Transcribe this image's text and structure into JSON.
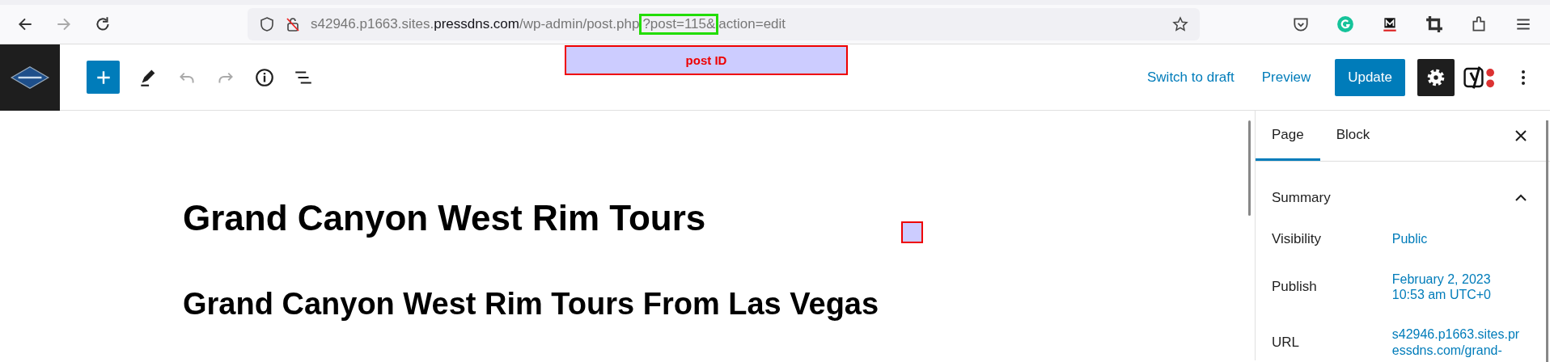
{
  "browser": {
    "url": {
      "host_prefix": "s42946.p1663.sites.",
      "host_domain": "pressdns.com",
      "path": "/wp-admin/post.php",
      "query_start": "?post=115&",
      "query_rest": "action=edit"
    },
    "forward_disabled": true
  },
  "editor_toolbar": {
    "undo_disabled": true,
    "redo_disabled": true,
    "actions": [
      {
        "kind": "link",
        "label": "Switch to draft"
      },
      {
        "kind": "link",
        "label": "Preview"
      },
      {
        "kind": "primary",
        "label": "Update"
      }
    ],
    "settings_on": true
  },
  "annotations": [
    {
      "kind": "callout",
      "label": "post ID"
    },
    {
      "kind": "marker"
    }
  ],
  "content": {
    "headings": [
      {
        "kind": "title",
        "text": "Grand Canyon West Rim Tours"
      },
      {
        "kind": "h2",
        "text": "Grand Canyon West Rim Tours From Las Vegas"
      }
    ]
  },
  "sidebar": {
    "tabs": [
      {
        "label": "Page",
        "selected": true
      },
      {
        "label": "Block",
        "selected": false
      }
    ],
    "panel": {
      "title": "Summary",
      "expanded": true,
      "rows": [
        {
          "label": "Visibility",
          "value": "Public"
        },
        {
          "label": "Publish",
          "value": "February 2, 2023 10:53 am UTC+0"
        },
        {
          "label": "URL",
          "value": "s42946.p1663.sites.pressdns.com/grand-"
        }
      ]
    }
  }
}
